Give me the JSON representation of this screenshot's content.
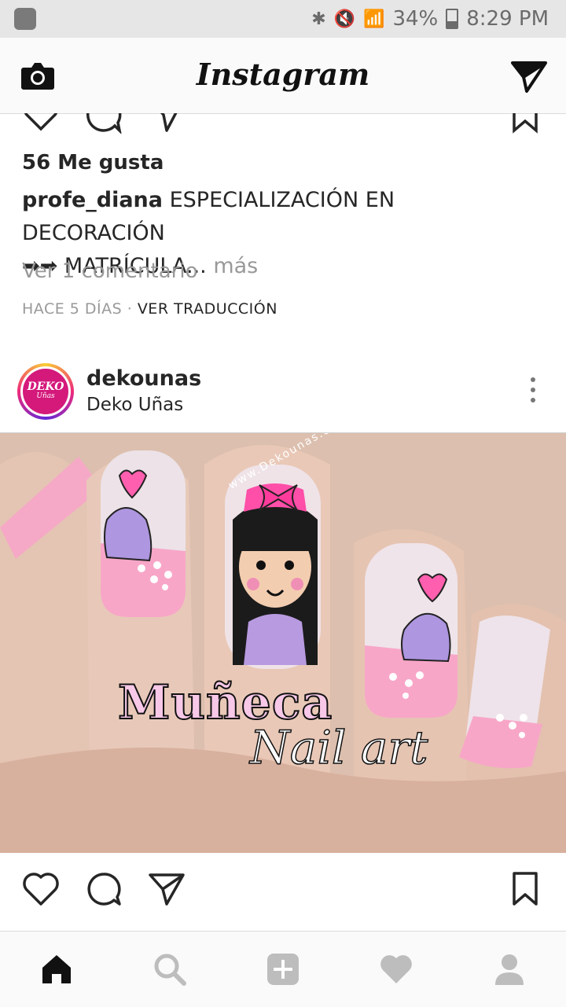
{
  "status_bar": {
    "battery": "34%",
    "time": "8:29 PM"
  },
  "header": {
    "title": "Instagram"
  },
  "post1": {
    "likes": "56 Me gusta",
    "caption_user": "profe_diana",
    "caption_text_line1": "ESPECIALIZACIÓN EN DECORACIÓN",
    "caption_text_line2": "➡➡ MATRÍCULA...",
    "more": "más",
    "comments": "Ver 1 comentario",
    "time": "HACE 5 DÍAS",
    "separator": " · ",
    "translate": "VER TRADUCCIÓN"
  },
  "post2": {
    "username": "dekounas",
    "location": "Deko Uñas",
    "avatar_line1": "DEKO",
    "avatar_line2": "Uñas",
    "image": {
      "watermark_url": "www.Dekounas.com",
      "title": "Muñeca",
      "subtitle": "Nail art"
    }
  },
  "icons": {
    "header_left": "camera-icon",
    "header_right": "direct-send-icon",
    "actions": [
      "heart-icon",
      "comment-icon",
      "share-icon",
      "bookmark-icon"
    ],
    "nav": [
      "home-icon",
      "search-icon",
      "add-icon",
      "activity-heart-icon",
      "profile-icon"
    ]
  },
  "colors": {
    "link": "#262626",
    "muted": "#999999",
    "brand_pink": "#d4197b"
  }
}
